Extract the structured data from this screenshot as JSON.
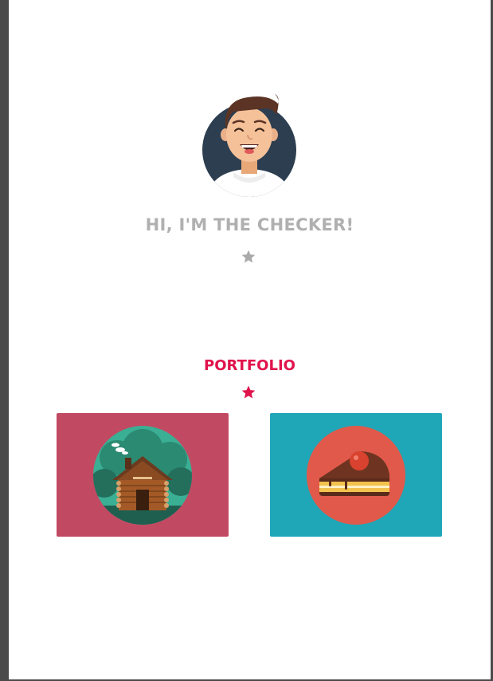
{
  "hero": {
    "title": "HI, I'M THE CHECKER!",
    "avatar_icon": "avatar-icon",
    "divider_icon": "star-icon",
    "divider_color": "#aaaaaa"
  },
  "portfolio": {
    "title": "PORTFOLIO",
    "title_color": "#e0134c",
    "divider_icon": "star-icon",
    "items": [
      {
        "icon": "cabin-icon",
        "background": "#c14a62"
      },
      {
        "icon": "cake-icon",
        "background": "#1fa7b8"
      }
    ]
  }
}
